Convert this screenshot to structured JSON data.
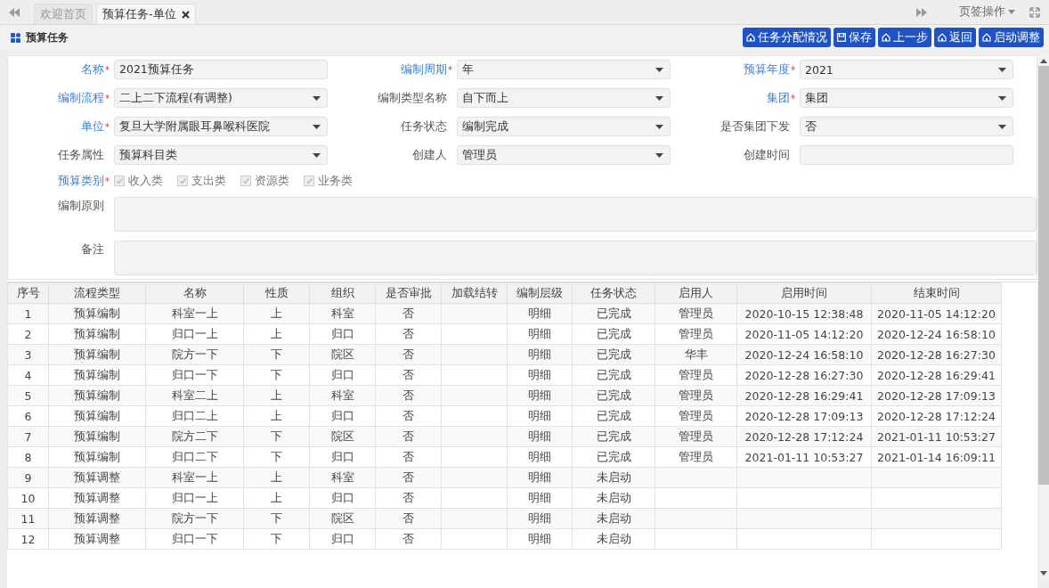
{
  "tabs": [
    {
      "label": "欢迎首页",
      "selected": false,
      "closable": false
    },
    {
      "label": "预算任务-单位",
      "selected": true,
      "closable": true
    }
  ],
  "tab_menu": {
    "label": "页签操作"
  },
  "page_title": "预算任务",
  "toolbar_buttons": [
    {
      "label": "任务分配情况",
      "kind": "home"
    },
    {
      "label": "保存",
      "kind": "save"
    },
    {
      "label": "上一步",
      "kind": "home"
    },
    {
      "label": "返回",
      "kind": "home"
    },
    {
      "label": "启动调整",
      "kind": "home"
    }
  ],
  "form_fields": [
    {
      "label": "名称",
      "required_mark": "*",
      "kind": "text",
      "value": "2021预算任务"
    },
    {
      "label": "编制周期",
      "required_mark": "*",
      "kind": "select",
      "value": "年"
    },
    {
      "label": "预算年度",
      "required_mark": "*",
      "kind": "select",
      "value": "2021"
    },
    {
      "label": "编制流程",
      "required_mark": "*",
      "kind": "select",
      "value": "二上二下流程(有调整)"
    },
    {
      "label": "编制类型名称",
      "kind": "select",
      "value": "自下而上"
    },
    {
      "label": "集团",
      "required_mark": "*",
      "kind": "select",
      "value": "集团"
    },
    {
      "label": "单位",
      "required_mark": "*",
      "kind": "select",
      "value": "复旦大学附属眼耳鼻喉科医院"
    },
    {
      "label": "任务状态",
      "kind": "select",
      "value": "编制完成"
    },
    {
      "label": "是否集团下发",
      "kind": "select",
      "value": "否"
    },
    {
      "label": "任务属性",
      "kind": "select",
      "value": "预算科目类"
    },
    {
      "label": "创建人",
      "kind": "select",
      "value": "管理员"
    },
    {
      "label": "创建时间",
      "kind": "text"
    }
  ],
  "budget_category": {
    "label": "预算类别",
    "required_mark": "*",
    "options": [
      {
        "label": "收入类",
        "checked": true,
        "disabled": true
      },
      {
        "label": "支出类",
        "checked": true,
        "disabled": true
      },
      {
        "label": "资源类",
        "checked": true,
        "disabled": true
      },
      {
        "label": "业务类",
        "checked": true,
        "disabled": true
      }
    ]
  },
  "text_areas": [
    {
      "label": "编制原则"
    },
    {
      "label": "备注"
    }
  ],
  "table": {
    "columns": [
      "序号",
      "流程类型",
      "名称",
      "性质",
      "组织",
      "是否审批",
      "加载结转",
      "编制层级",
      "任务状态",
      "启用人",
      "启用时间",
      "结束时间"
    ],
    "rows": [
      [
        "1",
        "预算编制",
        "科室一上",
        "上",
        "科室",
        "否",
        "",
        "明细",
        "已完成",
        "管理员",
        "2020-10-15 12:38:48",
        "2020-11-05 14:12:20"
      ],
      [
        "2",
        "预算编制",
        "归口一上",
        "上",
        "归口",
        "否",
        "",
        "明细",
        "已完成",
        "管理员",
        "2020-11-05 14:12:20",
        "2020-12-24 16:58:10"
      ],
      [
        "3",
        "预算编制",
        "院方一下",
        "下",
        "院区",
        "否",
        "",
        "明细",
        "已完成",
        "华丰",
        "2020-12-24 16:58:10",
        "2020-12-28 16:27:30"
      ],
      [
        "4",
        "预算编制",
        "归口一下",
        "下",
        "归口",
        "否",
        "",
        "明细",
        "已完成",
        "管理员",
        "2020-12-28 16:27:30",
        "2020-12-28 16:29:41"
      ],
      [
        "5",
        "预算编制",
        "科室二上",
        "上",
        "科室",
        "否",
        "",
        "明细",
        "已完成",
        "管理员",
        "2020-12-28 16:29:41",
        "2020-12-28 17:09:13"
      ],
      [
        "6",
        "预算编制",
        "归口二上",
        "上",
        "归口",
        "否",
        "",
        "明细",
        "已完成",
        "管理员",
        "2020-12-28 17:09:13",
        "2020-12-28 17:12:24"
      ],
      [
        "7",
        "预算编制",
        "院方二下",
        "下",
        "院区",
        "否",
        "",
        "明细",
        "已完成",
        "管理员",
        "2020-12-28 17:12:24",
        "2021-01-11 10:53:27"
      ],
      [
        "8",
        "预算编制",
        "归口二下",
        "下",
        "归口",
        "否",
        "",
        "明细",
        "已完成",
        "管理员",
        "2021-01-11 10:53:27",
        "2021-01-14 16:09:11"
      ],
      [
        "9",
        "预算调整",
        "科室一上",
        "上",
        "科室",
        "否",
        "",
        "明细",
        "未启动",
        "",
        "",
        ""
      ],
      [
        "10",
        "预算调整",
        "归口一上",
        "上",
        "归口",
        "否",
        "",
        "明细",
        "未启动",
        "",
        "",
        ""
      ],
      [
        "11",
        "预算调整",
        "院方一下",
        "下",
        "院区",
        "否",
        "",
        "明细",
        "未启动",
        "",
        "",
        ""
      ],
      [
        "12",
        "预算调整",
        "归口一下",
        "下",
        "归口",
        "否",
        "",
        "明细",
        "未启动",
        "",
        "",
        ""
      ]
    ]
  }
}
